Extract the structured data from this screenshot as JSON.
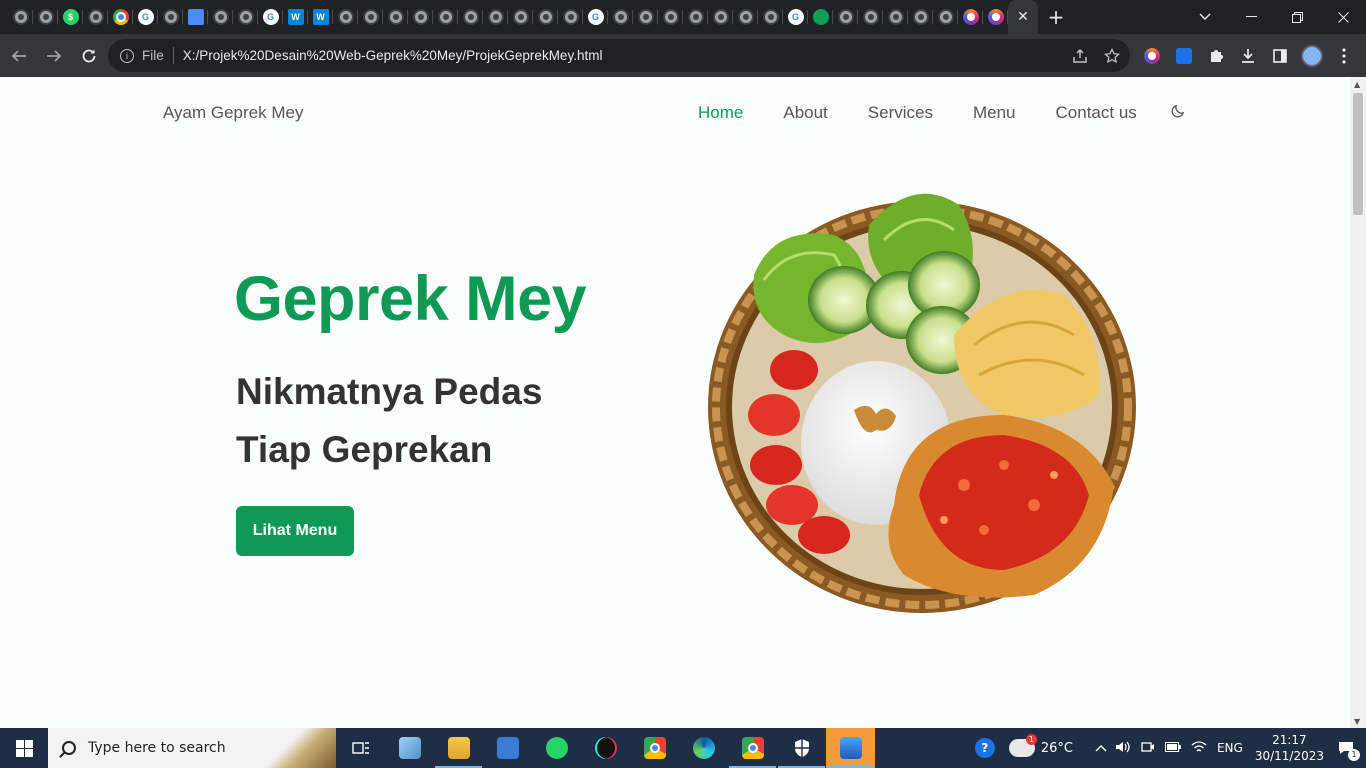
{
  "browser": {
    "address": {
      "scheme_label": "File",
      "url": "X:/Projek%20Desain%20Web-Geprek%20Mey/ProjekGeprekMey.html"
    },
    "active_tab_close": "✕",
    "new_tab": "+"
  },
  "site": {
    "brand": "Ayam Geprek Mey",
    "nav": [
      "Home",
      "About",
      "Services",
      "Menu",
      "Contact us"
    ],
    "active_nav": "Home",
    "accent_color": "#0e9a55",
    "hero": {
      "title": "Geprek Mey",
      "subtitle_line1": "Nikmatnya Pedas",
      "subtitle_line2": "Tiap Geprekan",
      "cta": "Lihat Menu"
    }
  },
  "taskbar": {
    "search_placeholder": "Type here to search",
    "weather": "26°C",
    "language": "ENG",
    "time": "21:17",
    "date": "30/11/2023",
    "notification_count": "1"
  }
}
